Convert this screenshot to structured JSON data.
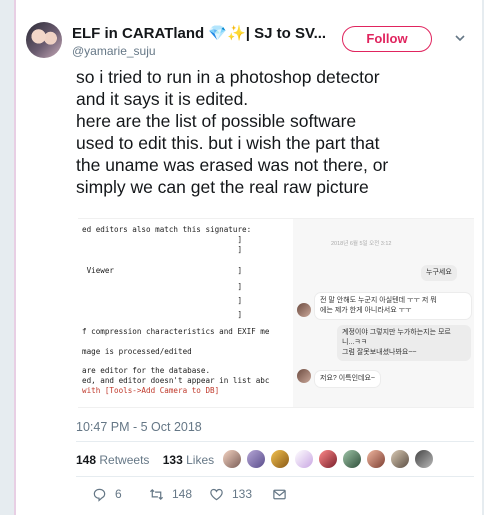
{
  "tweet": {
    "display_name": "ELF in CARATland",
    "display_name_emoji": "💎✨",
    "display_name_suffix": "| SJ to SV...",
    "handle": "@yamarie_suju",
    "follow_label": "Follow",
    "text_lines": [
      "so i tried to run in a photoshop detector",
      "and it says it is edited.",
      "here are the list of  possible software",
      "used to edit this. but i wish the part that",
      "the uname was erased was not there, or",
      "simply we can get the real raw picture"
    ],
    "timestamp": "10:47 PM - 5 Oct 2018",
    "retweets_count": "148",
    "retweets_label": "Retweets",
    "likes_count": "133",
    "likes_label": "Likes",
    "actions": {
      "reply_count": "6",
      "retweet_count": "148",
      "like_count": "133"
    },
    "colors": {
      "accent": "#e0245e",
      "secondary_text": "#657786",
      "link_blue": "#1da1f2"
    }
  },
  "media": {
    "code_lines": [
      "ed editors also match this signature:",
      "                                  ]",
      "                                  ]",
      " Viewer                           ]",
      "                                  ]",
      "                                  ]",
      "                                  ]",
      "f compression characteristics and EXIF me",
      "",
      "mage is processed/edited",
      "",
      "are editor for the database.",
      "ed, and editor doesn't appear in list abc"
    ],
    "code_red_line": "with [Tools->Add Camera to DB]",
    "chat": {
      "top_timestamp": "2018년 6월 5일 오전 3:12",
      "bubble_1": "누구세요",
      "bubble_2_line1": "전 말 안해도 누군지 아실텐데 ㅜㅜ 저 뭐",
      "bubble_2_line2": "에는 제가 한게 아니라서요 ㅜㅜ",
      "bubble_3_line1": "계정이야 그렇지만 누가하는지는 모르",
      "bubble_3_line2": "니...ㅋㅋ",
      "bubble_3_line3": "그럼 잘못보내셨나봐요~~",
      "bubble_4": "저요? 이특인데요~"
    }
  }
}
